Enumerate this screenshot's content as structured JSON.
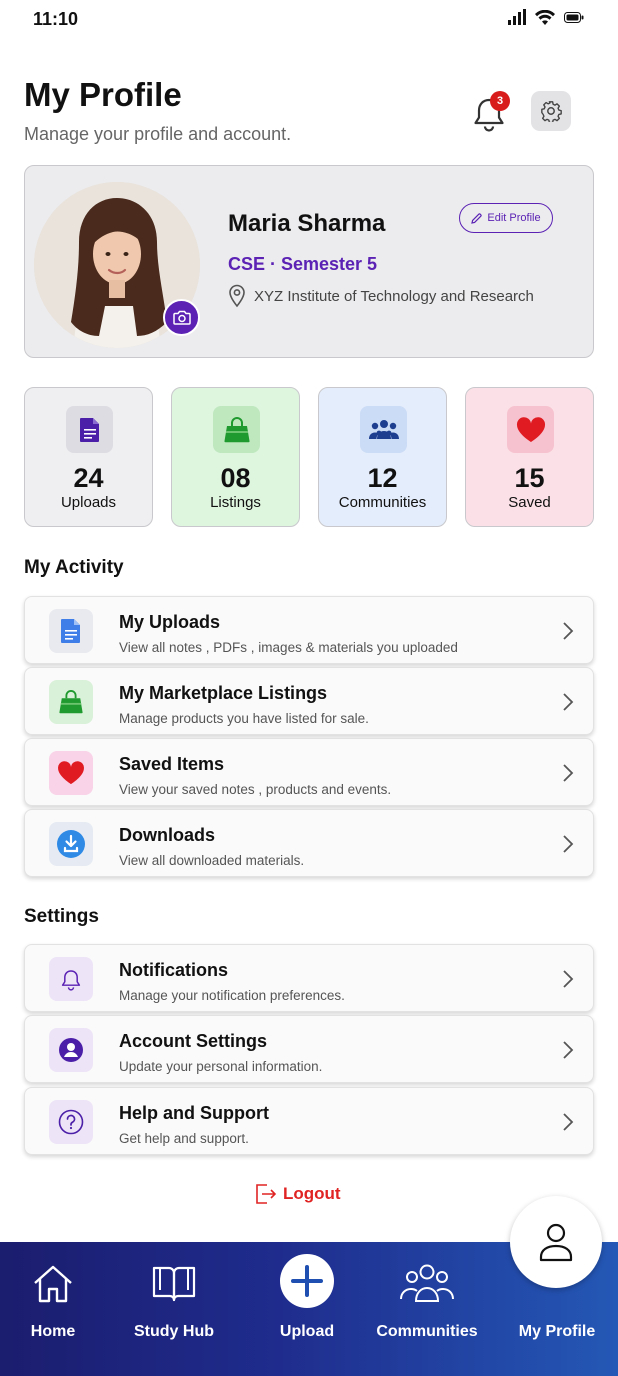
{
  "status": {
    "time": "11:10"
  },
  "header": {
    "title": "My Profile",
    "subtitle": "Manage your profile and account.",
    "notification_count": "3"
  },
  "profile": {
    "name": "Maria Sharma",
    "course": "CSE · Semester 5",
    "institute": "XYZ Institute of Technology and Research",
    "edit_label": "Edit Profile"
  },
  "stats": [
    {
      "value": "24",
      "label": "Uploads",
      "bg": "#efeff1",
      "icon_bg": "#dcdce2",
      "icon_color": "#4b1fa8"
    },
    {
      "value": "08",
      "label": "Listings",
      "bg": "#def5de",
      "icon_bg": "#bfe8bf",
      "icon_color": "#1f9a2e"
    },
    {
      "value": "12",
      "label": "Communities",
      "bg": "#e4edfb",
      "icon_bg": "#cbdcf6",
      "icon_color": "#1d3d8f"
    },
    {
      "value": "15",
      "label": "Saved",
      "bg": "#fbe1e7",
      "icon_bg": "#f6c2cf",
      "icon_color": "#e01b22"
    }
  ],
  "activity": {
    "title": "My Activity",
    "items": [
      {
        "title": "My Uploads",
        "desc": "View all notes , PDFs , images & materials you uploaded",
        "icon": "document-icon"
      },
      {
        "title": "My Marketplace Listings",
        "desc": "Manage products you have listed for sale.",
        "icon": "shopping-bag-icon"
      },
      {
        "title": "Saved Items",
        "desc": "View your saved notes , products and events.",
        "icon": "heart-icon"
      },
      {
        "title": "Downloads",
        "desc": "View all downloaded materials.",
        "icon": "download-icon"
      }
    ]
  },
  "settings": {
    "title": "Settings",
    "items": [
      {
        "title": "Notifications",
        "desc": "Manage your notification preferences.",
        "icon": "bell-icon"
      },
      {
        "title": "Account Settings",
        "desc": "Update your personal information.",
        "icon": "user-circle-icon"
      },
      {
        "title": "Help and Support",
        "desc": "Get help and support.",
        "icon": "question-icon"
      }
    ]
  },
  "logout_label": "Logout",
  "nav": {
    "home": "Home",
    "study_hub": "Study Hub",
    "upload": "Upload",
    "communities": "Communities",
    "my_profile": "My Profile"
  },
  "colors": {
    "accent": "#5b22b4",
    "logout": "#e02424",
    "nav_start": "#1b1d6e",
    "nav_end": "#2458b6"
  }
}
